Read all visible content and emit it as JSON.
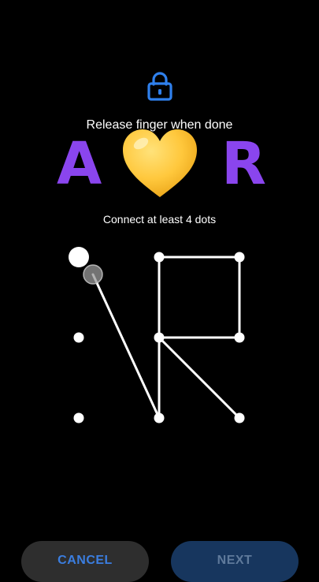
{
  "header": {
    "lock_icon": "lock-icon",
    "title": "Release finger when done"
  },
  "overlay": {
    "letter_left": "A",
    "heart_icon": "yellow-heart-emoji",
    "letter_right": "R"
  },
  "instructions": {
    "text": "Connect at least 4 dots"
  },
  "pattern": {
    "rows": 3,
    "cols": 3,
    "path_dot_indices": [
      4,
      1,
      2,
      5,
      4,
      7,
      8
    ],
    "separate_stroke_to_dot": 7,
    "active_touch_dot": 0
  },
  "buttons": {
    "cancel": "CANCEL",
    "next": "NEXT"
  },
  "colors": {
    "background": "#000000",
    "accent_blue": "#2f80ed",
    "letter_purple": "#8a45ee",
    "heart_yellow": "#ffc83d"
  }
}
